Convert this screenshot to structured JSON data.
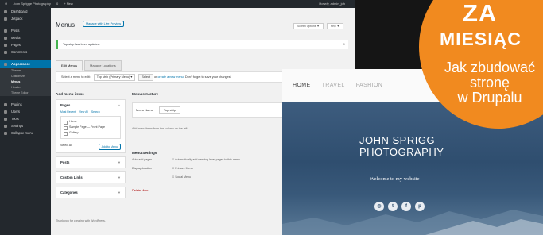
{
  "wp": {
    "topbar": {
      "site_name": "John Sprigge Photography",
      "comments_count": "0",
      "new_label": "+ New",
      "user": "Howdy, admin_joh"
    },
    "sidebar": {
      "items": [
        "Dashboard",
        "Jetpack",
        "Posts",
        "Media",
        "Pages",
        "Comments"
      ],
      "active": "Appearance",
      "submenu": [
        "Themes",
        "Customize",
        "Menus",
        "Header",
        "Theme Editor"
      ],
      "current_sub": "Menus",
      "items_after": [
        "Plugins",
        "Users",
        "Tools",
        "Settings",
        "Collapse menu"
      ]
    },
    "page_title": "Menus",
    "title_button": "Manage with Live Preview",
    "screen_options": "Screen Options ▼",
    "help": "Help ▼",
    "notice": "Top strip has been updated.",
    "tabs": [
      "Edit Menus",
      "Manage Locations"
    ],
    "edit_row": {
      "text": "Select a menu to edit:",
      "selected_menu": "Top strip (Primary Menu)",
      "select_button": "Select",
      "or": "or",
      "create_link": "create a new menu",
      "save_hint": ". Don't forget to save your changes!"
    },
    "add_items": {
      "heading": "Add menu items",
      "pages_heading": "Pages",
      "page_tabs": [
        "Most Recent",
        "View All",
        "Search"
      ],
      "pages": [
        "Home",
        "Sample Page — Front Page",
        "Gallery"
      ],
      "select_all": "Select All",
      "add_button": "Add to Menu",
      "other_sections": [
        "Posts",
        "Custom Links",
        "Categories"
      ]
    },
    "structure": {
      "heading": "Menu structure",
      "name_label": "Menu Name",
      "name_value": "Top strip",
      "note": "Add menu items from the column on the left.",
      "settings_heading": "Menu Settings",
      "auto_add_label": "Auto add pages",
      "auto_add_value": "Automatically add new top-level pages to this menu",
      "display_label": "Display location",
      "locations": [
        "Primary Menu",
        "Social Menu"
      ],
      "delete_link": "Delete Menu"
    },
    "footer": "Thank you for creating with WordPress."
  },
  "site": {
    "nav": [
      "HOME",
      "TRAVEL",
      "FASHION"
    ],
    "title_line1": "JOHN SPRIGG",
    "title_line2": "PHOTOGRAPHY",
    "subtitle": "Welcome to my website",
    "social_icons": [
      "instagram-icon",
      "twitter-icon",
      "facebook-icon",
      "pinterest-icon"
    ],
    "social_glyphs": [
      "◎",
      "t",
      "f",
      "p"
    ],
    "hero_color": "#2c4a6c"
  },
  "badge": {
    "line1": "ZA",
    "line2": "MIESIĄC",
    "line3": "Jak zbudować",
    "line4": "stronę",
    "line5": "w Drupalu",
    "color": "#f18a1f"
  }
}
